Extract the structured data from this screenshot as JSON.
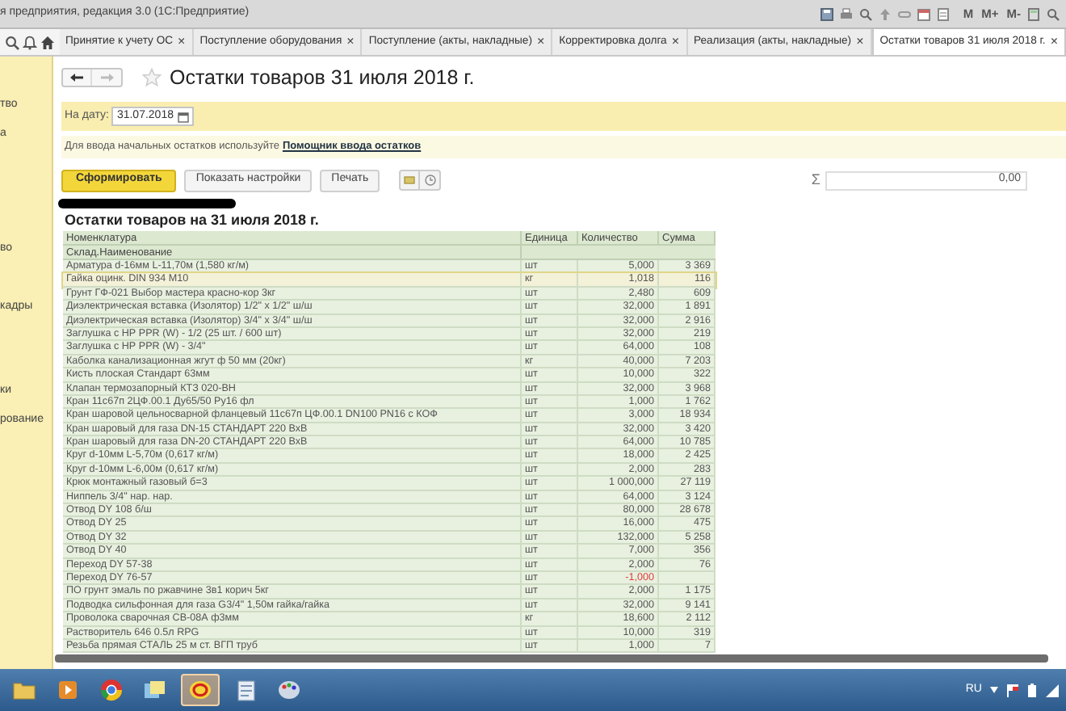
{
  "window": {
    "title": "я предприятия, редакция 3.0 (1С:Предприятие)",
    "memory_buttons": [
      "M",
      "M+",
      "M-"
    ]
  },
  "tabs": [
    {
      "label": "Принятие к учету ОС",
      "close": "×",
      "selected": false
    },
    {
      "label": "Поступление оборудования",
      "close": "×",
      "selected": false
    },
    {
      "label": "Поступление (акты, накладные)",
      "close": "×",
      "selected": false
    },
    {
      "label": "Корректировка долга",
      "close": "×",
      "selected": false
    },
    {
      "label": "Реализация (акты, накладные)",
      "close": "×",
      "selected": false
    },
    {
      "label": "Остатки товаров 31 июля 2018 г.",
      "close": "×",
      "selected": true
    }
  ],
  "sidebar": {
    "items": [
      "тво",
      "а",
      "во",
      "кадры",
      "ки",
      "рование"
    ]
  },
  "form": {
    "title": "Остатки товаров 31 июля 2018 г.",
    "date_label": "На дату:",
    "date_value": "31.07.2018",
    "hint": "Для ввода начальных остатков используйте",
    "hint_link": "Помощник ввода остатков",
    "buttons": [
      {
        "label": "Сформировать",
        "kind": "primary"
      },
      {
        "label": "Показать настройки",
        "kind": "normal"
      },
      {
        "label": "Печать",
        "kind": "normal"
      }
    ],
    "sum_sign": "Σ",
    "sum_value": "0,00"
  },
  "report": {
    "title": "Остатки товаров на 31 июля 2018 г.",
    "columns": [
      "Номенклатура",
      "Единица",
      "Количество",
      "Сумма"
    ],
    "subheader": "Склад.Наименование",
    "rows": [
      {
        "name": "Арматура d-16мм L-11,70м (1,580 кг/м)",
        "unit": "шт",
        "qty": "5,000",
        "sum": "3 369",
        "selected": false,
        "negative": false
      },
      {
        "name": "Гайка оцинк. DIN 934 M10",
        "unit": "кг",
        "qty": "1,018",
        "sum": "116",
        "selected": true,
        "negative": false
      },
      {
        "name": "Грунт ГФ-021 Выбор мастера красно-кор 3кг",
        "unit": "шт",
        "qty": "2,480",
        "sum": "609",
        "selected": false,
        "negative": false
      },
      {
        "name": "Диэлектрическая вставка (Изолятор) 1/2\" x 1/2\" ш/ш",
        "unit": "шт",
        "qty": "32,000",
        "sum": "1 891",
        "selected": false,
        "negative": false
      },
      {
        "name": "Диэлектрическая вставка (Изолятор) 3/4\" x 3/4\" ш/ш",
        "unit": "шт",
        "qty": "32,000",
        "sum": "2 916",
        "selected": false,
        "negative": false
      },
      {
        "name": "Заглушка с НР PPR (W) - 1/2 (25 шт. / 600 шт)",
        "unit": "шт",
        "qty": "32,000",
        "sum": "219",
        "selected": false,
        "negative": false
      },
      {
        "name": "Заглушка с НР PPR (W) - 3/4\"",
        "unit": "шт",
        "qty": "64,000",
        "sum": "108",
        "selected": false,
        "negative": false
      },
      {
        "name": "Каболка канализационная жгут ф 50 мм (20кг)",
        "unit": "кг",
        "qty": "40,000",
        "sum": "7 203",
        "selected": false,
        "negative": false
      },
      {
        "name": "Кисть плоская Стандарт 63мм",
        "unit": "шт",
        "qty": "10,000",
        "sum": "322",
        "selected": false,
        "negative": false
      },
      {
        "name": "Клапан термозапорный КТЗ 020-ВН",
        "unit": "шт",
        "qty": "32,000",
        "sum": "3 968",
        "selected": false,
        "negative": false
      },
      {
        "name": "Кран 11с67п 2ЦФ.00.1 Ду65/50 Ру16 фл",
        "unit": "шт",
        "qty": "1,000",
        "sum": "1 762",
        "selected": false,
        "negative": false
      },
      {
        "name": "Кран шаровой цельносварной фланцевый 11с67п ЦФ.00.1 DN100 PN16 с КОФ",
        "unit": "шт",
        "qty": "3,000",
        "sum": "18 934",
        "selected": false,
        "negative": false
      },
      {
        "name": "Кран шаровый для газа DN-15 СТАНДАРТ 220 ВхВ",
        "unit": "шт",
        "qty": "32,000",
        "sum": "3 420",
        "selected": false,
        "negative": false
      },
      {
        "name": "Кран шаровый для газа DN-20 СТАНДАРТ 220 ВхВ",
        "unit": "шт",
        "qty": "64,000",
        "sum": "10 785",
        "selected": false,
        "negative": false
      },
      {
        "name": "Круг d-10мм L-5,70м (0,617 кг/м)",
        "unit": "шт",
        "qty": "18,000",
        "sum": "2 425",
        "selected": false,
        "negative": false
      },
      {
        "name": "Круг d-10мм L-6,00м (0,617 кг/м)",
        "unit": "шт",
        "qty": "2,000",
        "sum": "283",
        "selected": false,
        "negative": false
      },
      {
        "name": "Крюк монтажный газовый б=3",
        "unit": "шт",
        "qty": "1 000,000",
        "sum": "27 119",
        "selected": false,
        "negative": false
      },
      {
        "name": "Ниппель 3/4\" нар. нар.",
        "unit": "шт",
        "qty": "64,000",
        "sum": "3 124",
        "selected": false,
        "negative": false
      },
      {
        "name": "Отвод DY 108 б/ш",
        "unit": "шт",
        "qty": "80,000",
        "sum": "28 678",
        "selected": false,
        "negative": false
      },
      {
        "name": "Отвод DY 25",
        "unit": "шт",
        "qty": "16,000",
        "sum": "475",
        "selected": false,
        "negative": false
      },
      {
        "name": "Отвод DY 32",
        "unit": "шт",
        "qty": "132,000",
        "sum": "5 258",
        "selected": false,
        "negative": false
      },
      {
        "name": "Отвод DY 40",
        "unit": "шт",
        "qty": "7,000",
        "sum": "356",
        "selected": false,
        "negative": false
      },
      {
        "name": "Переход DY 57-38",
        "unit": "шт",
        "qty": "2,000",
        "sum": "76",
        "selected": false,
        "negative": false
      },
      {
        "name": "Переход DY 76-57",
        "unit": "шт",
        "qty": "-1,000",
        "selected": false,
        "negative": true
      },
      {
        "name": "ПО грунт эмаль по ржавчине 3в1 корич 5кг",
        "unit": "шт",
        "qty": "2,000",
        "sum": "1 175",
        "selected": false,
        "negative": false
      },
      {
        "name": "Подводка сильфонная для газа G3/4\" 1,50м гайка/гайка",
        "unit": "шт",
        "qty": "32,000",
        "sum": "9 141",
        "selected": false,
        "negative": false
      },
      {
        "name": "Проволока сварочная СВ-08А ф3мм",
        "unit": "кг",
        "qty": "18,600",
        "sum": "2 112",
        "selected": false,
        "negative": false
      },
      {
        "name": "Растворитель 646 0.5л RPG",
        "unit": "шт",
        "qty": "10,000",
        "sum": "319",
        "selected": false,
        "negative": false
      },
      {
        "name": "Резьба прямая СТАЛЬ 25 м ст. ВГП труб",
        "unit": "шт",
        "qty": "1,000",
        "sum": "7",
        "selected": false,
        "negative": false
      }
    ]
  },
  "taskbar": {
    "language": "RU"
  }
}
